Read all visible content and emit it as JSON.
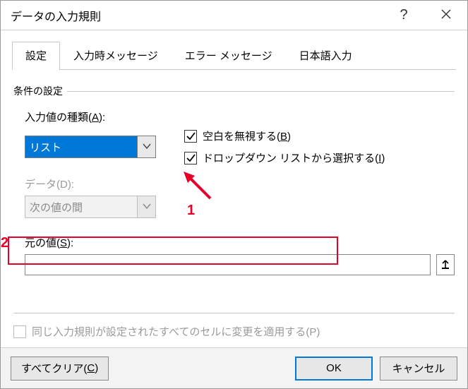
{
  "titlebar": {
    "title": "データの入力規則",
    "help": "?",
    "close": "×"
  },
  "tabs": {
    "settings": "設定",
    "input_message": "入力時メッセージ",
    "error_message": "エラー メッセージ",
    "ime": "日本語入力"
  },
  "group": {
    "label": "条件の設定"
  },
  "allow": {
    "label_pre": "入力値の種類(",
    "label_hot": "A",
    "label_post": "):",
    "value": "リスト"
  },
  "data_field": {
    "label": "データ(D):",
    "value": "次の値の間"
  },
  "ignore_blank": {
    "label_pre": "空白を無視する(",
    "label_hot": "B",
    "label_post": ")",
    "checked": true
  },
  "dropdown": {
    "label_pre": "ドロップダウン リストから選択する(",
    "label_hot": "I",
    "label_post": ")",
    "checked": true
  },
  "source": {
    "label_pre": "元の値(",
    "label_hot": "S",
    "label_post": "):",
    "value": ""
  },
  "apply_all": {
    "label": "同じ入力規則が設定されたすべてのセルに変更を適用する(P)",
    "checked": false
  },
  "buttons": {
    "clear_pre": "すべてクリア(",
    "clear_hot": "C",
    "clear_post": ")",
    "ok": "OK",
    "cancel": "キャンセル"
  },
  "annotations": {
    "n1": "1",
    "n2": "2"
  }
}
